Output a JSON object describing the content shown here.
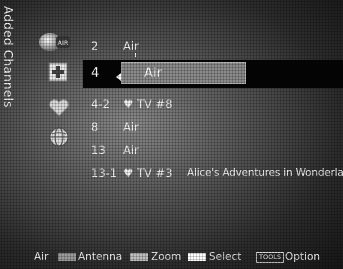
{
  "sidebar": {
    "title": "Added Channels",
    "icons": [
      {
        "name": "air-antenna-icon",
        "badge": "AIR",
        "selected": true
      },
      {
        "name": "added-channel-plus-icon"
      },
      {
        "name": "favorite-heart-icon"
      },
      {
        "name": "globe-icon"
      }
    ]
  },
  "channels": [
    {
      "number": "2",
      "type": "Air",
      "program": ""
    },
    {
      "number": "4",
      "type": "Air",
      "program": "",
      "selected": true
    },
    {
      "number": "4-2",
      "type": "♥ TV #8",
      "program": ""
    },
    {
      "number": "8",
      "type": "Air",
      "program": ""
    },
    {
      "number": "13",
      "type": "Air",
      "program": ""
    },
    {
      "number": "13-1",
      "type": "♥ TV #3",
      "program": "Alice's Adventures in Wonderland"
    }
  ],
  "footer": {
    "source": "Air",
    "antenna_label": "Antenna",
    "zoom_label": "Zoom",
    "select_label": "Select",
    "tools_label": "TOOLS",
    "option_label": "Option"
  },
  "colors": {
    "antenna_key": "#9a9a9a",
    "zoom_key": "#bdbdbd",
    "select_key": "#ffffff"
  }
}
